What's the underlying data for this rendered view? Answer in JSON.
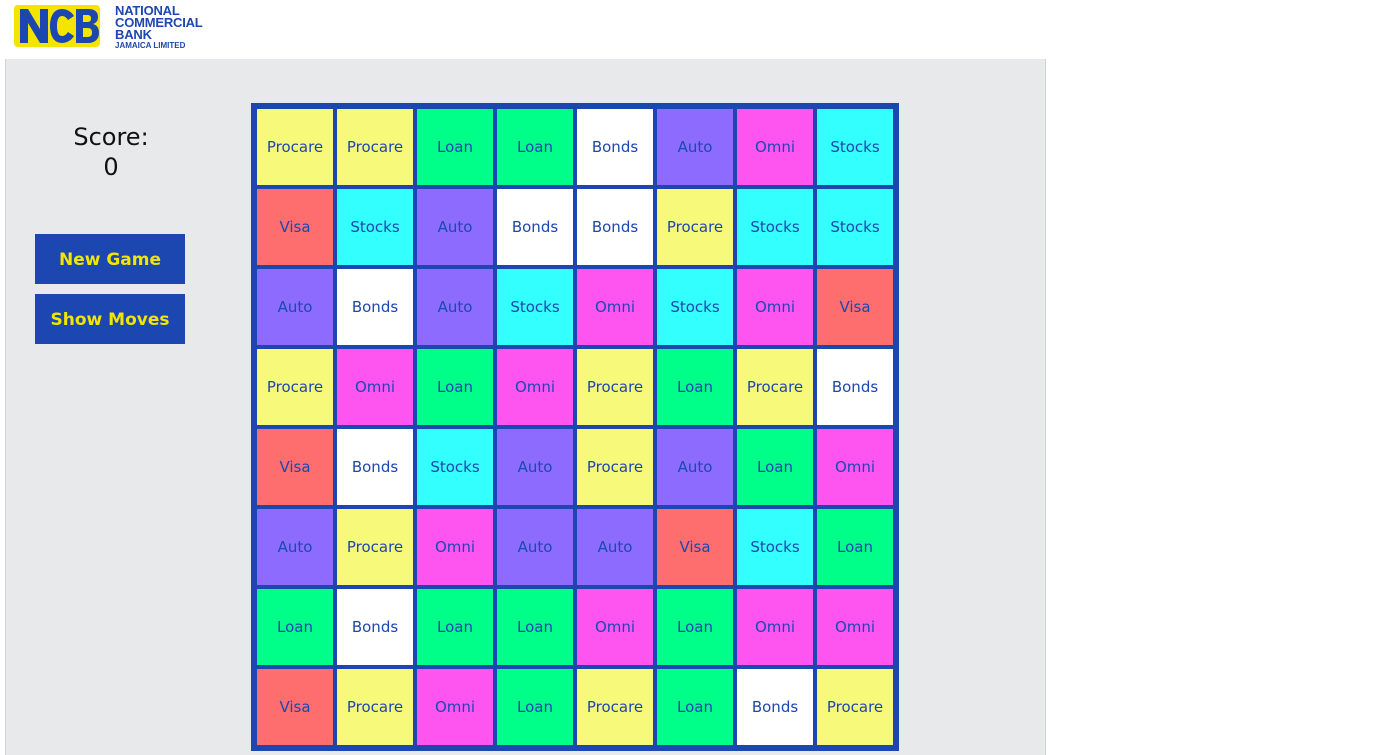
{
  "brand": {
    "line1": "NATIONAL",
    "line2": "COMMERCIAL",
    "line3": "BANK",
    "line4": "JAMAICA LIMITED",
    "logo_mark": "NCB",
    "colors": {
      "blue": "#1c47b0",
      "yellow": "#f3e500"
    }
  },
  "score": {
    "label": "Score:",
    "value": "0"
  },
  "buttons": {
    "new_game": "New Game",
    "show_moves": "Show Moves"
  },
  "tile_colors": {
    "Procare": "#f6f97a",
    "Loan": "#00ff88",
    "Bonds": "#ffffff",
    "Auto": "#8d6bff",
    "Omni": "#ff55f0",
    "Stocks": "#33ffff",
    "Visa": "#ff6e6e"
  },
  "board": [
    [
      "Procare",
      "Procare",
      "Loan",
      "Loan",
      "Bonds",
      "Auto",
      "Omni",
      "Stocks"
    ],
    [
      "Visa",
      "Stocks",
      "Auto",
      "Bonds",
      "Bonds",
      "Procare",
      "Stocks",
      "Stocks"
    ],
    [
      "Auto",
      "Bonds",
      "Auto",
      "Stocks",
      "Omni",
      "Stocks",
      "Omni",
      "Visa"
    ],
    [
      "Procare",
      "Omni",
      "Loan",
      "Omni",
      "Procare",
      "Loan",
      "Procare",
      "Bonds"
    ],
    [
      "Visa",
      "Bonds",
      "Stocks",
      "Auto",
      "Procare",
      "Auto",
      "Loan",
      "Omni"
    ],
    [
      "Auto",
      "Procare",
      "Omni",
      "Auto",
      "Auto",
      "Visa",
      "Stocks",
      "Loan"
    ],
    [
      "Loan",
      "Bonds",
      "Loan",
      "Loan",
      "Omni",
      "Loan",
      "Omni",
      "Omni"
    ],
    [
      "Visa",
      "Procare",
      "Omni",
      "Loan",
      "Procare",
      "Loan",
      "Bonds",
      "Procare"
    ]
  ]
}
